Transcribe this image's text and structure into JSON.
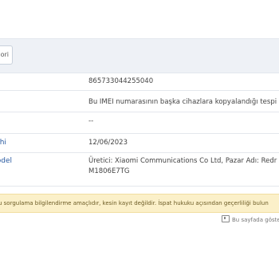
{
  "toolbar": {
    "button_label": "ori"
  },
  "rows": [
    {
      "label": "",
      "value": "865733044255040"
    },
    {
      "label": "",
      "value": "Bu IMEI numarasının başka cihazlara kopyalandığı tespi"
    },
    {
      "label": "",
      "value": "--"
    },
    {
      "label": "arihi",
      "value": "12/06/2023"
    },
    {
      "label": "Model",
      "value": "Üretici: Xiaomi Communications Co Ltd, Pazar Adı: Redr M1806E7TG"
    }
  ],
  "notice": {
    "text": "u sorgulama bilgilendirme amaçlıdır, kesin kayıt değildir. İspat hukuku açısından geçerliliği bulun"
  },
  "footer": {
    "icon": "document-icon",
    "text": "Bu sayfada göste"
  },
  "colors": {
    "label": "#2a5aa0",
    "notice_bg": "#fbf0c9",
    "toolbar_bg": "#eef1f6"
  }
}
